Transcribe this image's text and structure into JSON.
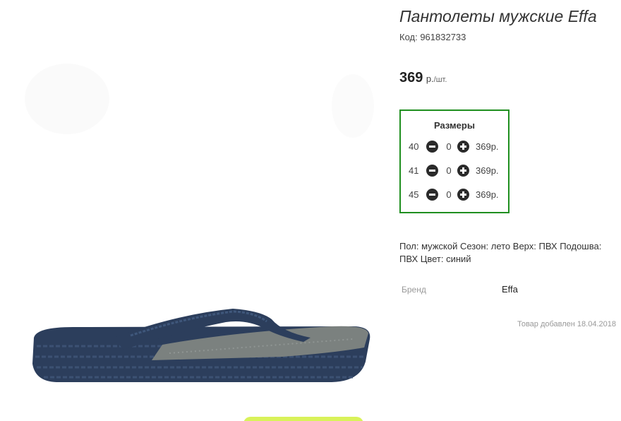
{
  "product": {
    "title": "Пантолеты мужские Effa",
    "code": "Код: 961832733",
    "price_value": "369",
    "price_currency": "р.",
    "price_per": "/шт."
  },
  "sizes": {
    "title": "Размеры",
    "rows": [
      {
        "size": "40",
        "qty": "0",
        "price": "369р."
      },
      {
        "size": "41",
        "qty": "0",
        "price": "369р."
      },
      {
        "size": "45",
        "qty": "0",
        "price": "369р."
      }
    ]
  },
  "description": "Пол: мужской Сезон: лето Верх: ПВХ Подошва: ПВХ Цвет: синий",
  "brand": {
    "label": "Бренд",
    "value": "Effa"
  },
  "added": "Товар добавлен 18.04.2018",
  "colors": {
    "frame": "#1f8f1f",
    "sandal": "#2c3e5c",
    "footbed": "#7b817f",
    "cta": "#d9f25a"
  },
  "icons": {
    "minus": "minus-circle-icon",
    "plus": "plus-circle-icon"
  }
}
